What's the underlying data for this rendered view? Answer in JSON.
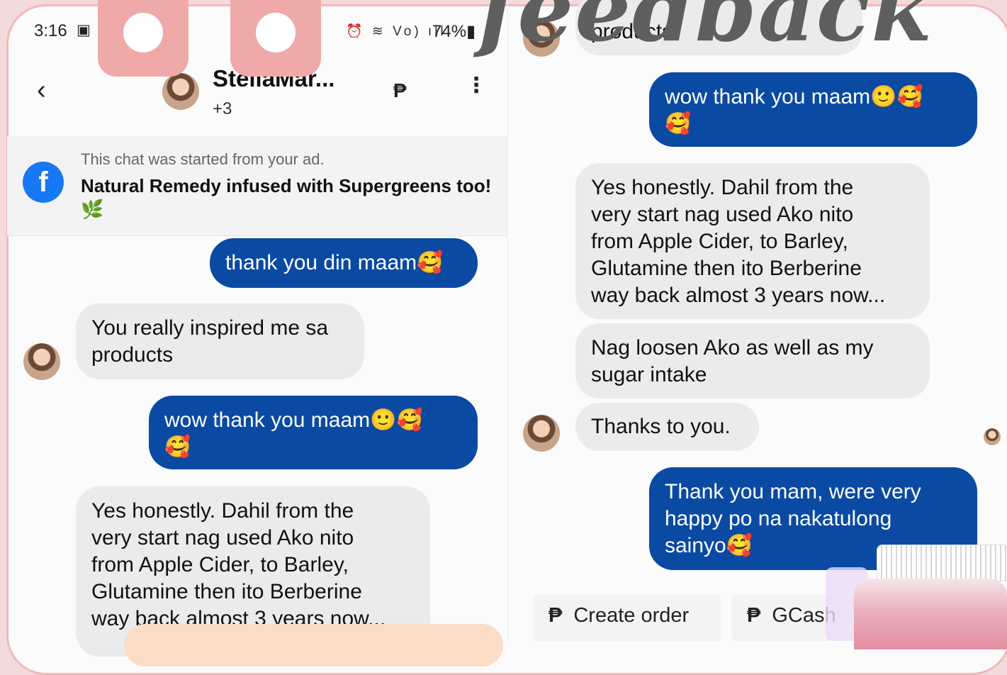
{
  "status_bar": {
    "time": "3:16",
    "left_icons": "▣ ◔ •",
    "right_icons": "⏰ ≋ Vo) ıll",
    "battery": "74%▮"
  },
  "header": {
    "contact_name": "StellaMar...",
    "contact_sub": "+3",
    "peso_symbol": "₱",
    "more_symbol": "⋮",
    "back_symbol": "‹"
  },
  "overlay": {
    "title_script": "feedback"
  },
  "ad": {
    "note": "This chat was started from your ad.",
    "title": "Natural Remedy infused with Supergreens too!🌿",
    "icon_letter": "f"
  },
  "left_panel": {
    "messages": [
      {
        "direction": "out",
        "text": "thank you din maam🥰"
      },
      {
        "direction": "in",
        "text": "You really inspired me sa\nproducts"
      },
      {
        "direction": "out",
        "text": "wow thank you maam🙂🥰\n🥰"
      },
      {
        "direction": "in",
        "text": "Yes honestly. Dahil from the\nvery start nag used Ako nito\nfrom Apple Cider, to Barley,\nGlutamine then ito Berberine\nway back almost 3 years now..."
      }
    ]
  },
  "right_panel": {
    "messages": [
      {
        "direction": "in",
        "text": "products"
      },
      {
        "direction": "out",
        "text": "wow thank you maam🙂🥰\n🥰"
      },
      {
        "direction": "in",
        "text": "Yes honestly. Dahil from the\nvery start nag used Ako nito\nfrom Apple Cider, to Barley,\nGlutamine then ito Berberine\nway back almost 3 years now..."
      },
      {
        "direction": "in",
        "text": "Nag loosen Ako as well as my\nsugar intake"
      },
      {
        "direction": "in",
        "text": "Thanks to you."
      },
      {
        "direction": "out",
        "text": "Thank you mam, were very\nhappy po na nakatulong\nsainyo🥰"
      }
    ],
    "actions": [
      {
        "icon": "₱",
        "label": "Create order"
      },
      {
        "icon": "₱",
        "label": "GCash"
      }
    ]
  },
  "colors": {
    "outgoing_bubble": "#0a4aa3",
    "incoming_bubble": "#ebebeb",
    "frame_border": "#f2b8b8",
    "facebook_blue": "#1877f2"
  }
}
